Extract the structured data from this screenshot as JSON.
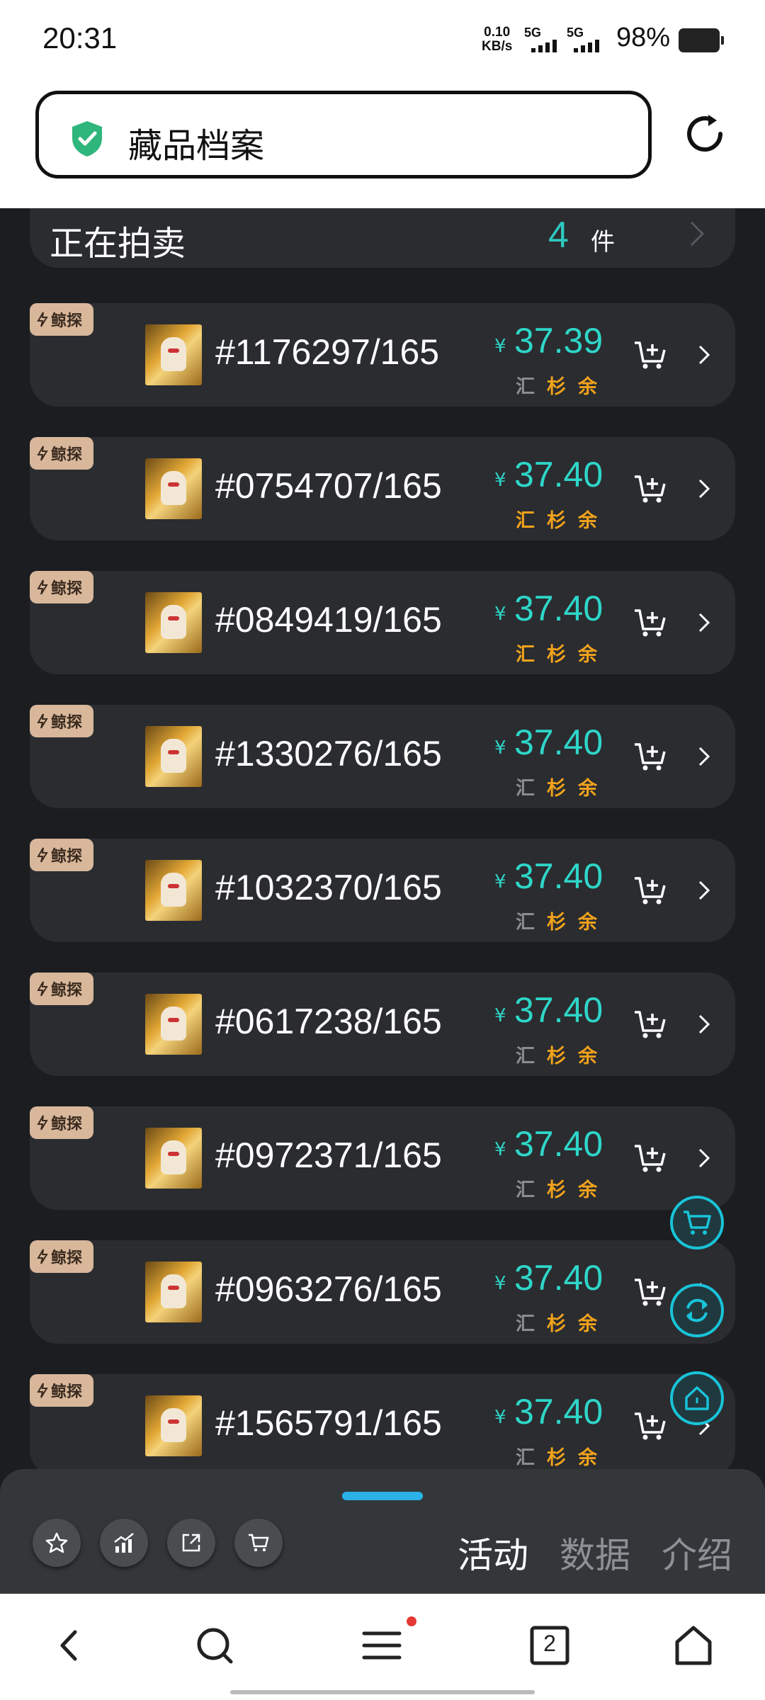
{
  "status_bar": {
    "time": "20:31",
    "net_speed_value": "0.10",
    "net_speed_unit": "KB/s",
    "sim1": "5G",
    "sim2": "5G",
    "battery": "98%"
  },
  "url_bar": {
    "title": "藏品档案"
  },
  "auction": {
    "label": "正在拍卖",
    "count": "4",
    "unit": "件"
  },
  "listings": [
    {
      "tag": "鲸探",
      "serial": "#1176297/165",
      "currency": "¥",
      "price": "37.39",
      "marks": [
        "汇",
        "杉",
        "余"
      ],
      "mark_colors": [
        "#8a8d90",
        "#f2a31b",
        "#f2a31b"
      ]
    },
    {
      "tag": "鲸探",
      "serial": "#0754707/165",
      "currency": "¥",
      "price": "37.40",
      "marks": [
        "汇",
        "杉",
        "余"
      ],
      "mark_colors": [
        "#f2a31b",
        "#f2a31b",
        "#f2a31b"
      ]
    },
    {
      "tag": "鲸探",
      "serial": "#0849419/165",
      "currency": "¥",
      "price": "37.40",
      "marks": [
        "汇",
        "杉",
        "余"
      ],
      "mark_colors": [
        "#f2a31b",
        "#f2a31b",
        "#f2a31b"
      ]
    },
    {
      "tag": "鲸探",
      "serial": "#1330276/165",
      "currency": "¥",
      "price": "37.40",
      "marks": [
        "汇",
        "杉",
        "余"
      ],
      "mark_colors": [
        "#8a8d90",
        "#f2a31b",
        "#f2a31b"
      ]
    },
    {
      "tag": "鲸探",
      "serial": "#1032370/165",
      "currency": "¥",
      "price": "37.40",
      "marks": [
        "汇",
        "杉",
        "余"
      ],
      "mark_colors": [
        "#8a8d90",
        "#f2a31b",
        "#f2a31b"
      ]
    },
    {
      "tag": "鲸探",
      "serial": "#0617238/165",
      "currency": "¥",
      "price": "37.40",
      "marks": [
        "汇",
        "杉",
        "余"
      ],
      "mark_colors": [
        "#8a8d90",
        "#f2a31b",
        "#f2a31b"
      ]
    },
    {
      "tag": "鲸探",
      "serial": "#0972371/165",
      "currency": "¥",
      "price": "37.40",
      "marks": [
        "汇",
        "杉",
        "余"
      ],
      "mark_colors": [
        "#8a8d90",
        "#f2a31b",
        "#f2a31b"
      ]
    },
    {
      "tag": "鲸探",
      "serial": "#0963276/165",
      "currency": "¥",
      "price": "37.40",
      "marks": [
        "汇",
        "杉",
        "余"
      ],
      "mark_colors": [
        "#8a8d90",
        "#f2a31b",
        "#f2a31b"
      ]
    },
    {
      "tag": "鲸探",
      "serial": "#1565791/165",
      "currency": "¥",
      "price": "37.40",
      "marks": [
        "汇",
        "杉",
        "余"
      ],
      "mark_colors": [
        "#8a8d90",
        "#f2a31b",
        "#f2a31b"
      ]
    }
  ],
  "floating_buttons": [
    "cart-icon",
    "refresh-icon",
    "home-icon"
  ],
  "bottom_panel": {
    "actions": [
      "star-icon",
      "trend-chart-icon",
      "share-icon",
      "cart-icon"
    ],
    "tabs": [
      {
        "label": "活动",
        "active": true
      },
      {
        "label": "数据",
        "active": false
      },
      {
        "label": "介绍",
        "active": false
      }
    ]
  },
  "browser_nav": {
    "tab_count": "2",
    "icons": [
      "back-icon",
      "search-icon",
      "menu-icon",
      "tabs-icon",
      "home-icon"
    ]
  },
  "colors": {
    "accent_teal": "#2ed6c8",
    "mark_orange": "#f2a31b",
    "mark_gray": "#8a8d90",
    "card_bg": "#2a2c30",
    "page_bg": "#1b1d20",
    "fab_ring": "#19c3d8"
  }
}
